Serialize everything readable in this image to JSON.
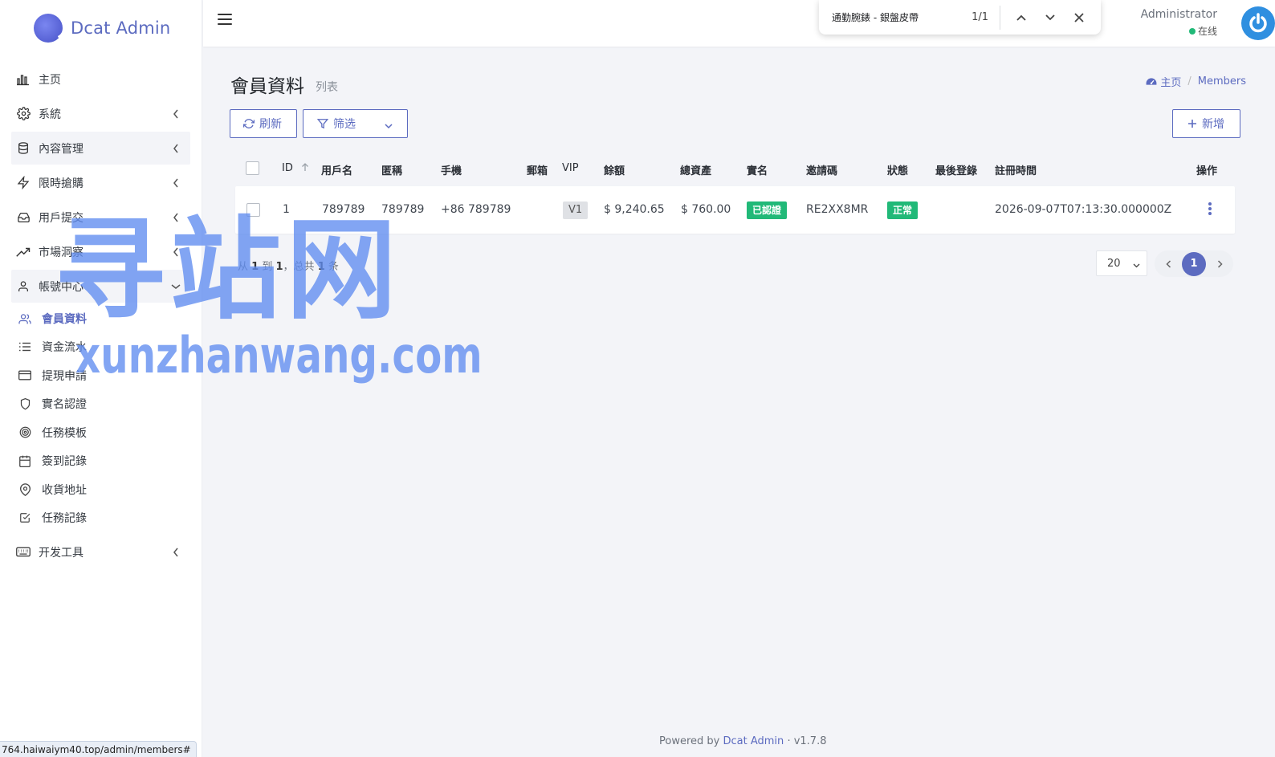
{
  "brand": {
    "name": "Dcat Admin"
  },
  "sidebar": {
    "items": [
      {
        "label": "主页",
        "icon": "bar-chart-icon",
        "chevron": false
      },
      {
        "label": "系統",
        "icon": "gear-icon",
        "chevron": true
      },
      {
        "label": "內容管理",
        "icon": "database-icon",
        "chevron": true
      },
      {
        "label": "限時搶購",
        "icon": "lightning-icon",
        "chevron": true
      },
      {
        "label": "用戶提交",
        "icon": "inbox-icon",
        "chevron": true
      },
      {
        "label": "市場洞察",
        "icon": "trending-up-icon",
        "chevron": true
      },
      {
        "label": "帳號中心",
        "icon": "user-icon",
        "chevron": true
      }
    ],
    "subitems": [
      {
        "label": "會員資料",
        "icon": "users-icon",
        "active": true
      },
      {
        "label": "資金流水",
        "icon": "list-icon"
      },
      {
        "label": "提現申請",
        "icon": "credit-card-icon"
      },
      {
        "label": "實名認證",
        "icon": "shield-icon"
      },
      {
        "label": "任務模板",
        "icon": "target-icon"
      },
      {
        "label": "簽到記錄",
        "icon": "calendar-icon"
      },
      {
        "label": "收貨地址",
        "icon": "map-pin-icon"
      },
      {
        "label": "任務記錄",
        "icon": "check-square-icon"
      }
    ],
    "dev": {
      "label": "开发工具",
      "icon": "keyboard-icon"
    }
  },
  "statusbar": {
    "url": "764.haiwaiym40.top/admin/members#"
  },
  "findbar": {
    "query": "通勤腕錶 - 銀盤皮帶",
    "count": "1/1"
  },
  "user": {
    "name": "Administrator",
    "status": "在线",
    "status_color": "#21b978"
  },
  "page": {
    "title": "會員資料",
    "subtitle": "列表"
  },
  "breadcrumb": {
    "home": "主页",
    "current": "Members"
  },
  "toolbar": {
    "refresh": "刷新",
    "filter": "筛选",
    "create": "新增"
  },
  "table": {
    "columns": [
      "ID",
      "用戶名",
      "匿稱",
      "手機",
      "郵箱",
      "VIP",
      "餘額",
      "總資產",
      "實名",
      "邀請碼",
      "狀態",
      "最後登錄",
      "註冊時間",
      "操作"
    ],
    "rows": [
      {
        "id": "1",
        "username": "789789",
        "nickname": "789789",
        "phone": "+86 789789",
        "email": "",
        "vip": "V1",
        "balance": "$ 9,240.65",
        "assets": "$ 760.00",
        "verified": "已認證",
        "invite": "RE2XX8MR",
        "status": "正常",
        "last_login": "",
        "registered": "2026-09-07T07:13:30.000000Z"
      }
    ]
  },
  "pagination": {
    "summary_from": "从",
    "summary_start": "1",
    "summary_to": "到",
    "summary_end": "1",
    "summary_total_prefix": "，总共",
    "summary_total": "1",
    "summary_unit": "条",
    "page_size": "20",
    "current_page": "1"
  },
  "footer": {
    "powered": "Powered by",
    "link": "Dcat Admin",
    "version": "v1.7.8"
  },
  "watermark": {
    "cn": "寻站网",
    "en": "xunzhanwang.com"
  },
  "colors": {
    "accent": "#5c6bc0",
    "success": "#21b978",
    "background": "#f3f4f8"
  }
}
